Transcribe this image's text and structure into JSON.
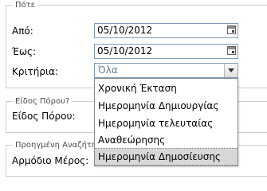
{
  "when_section": {
    "legend": "Πότε",
    "from_label": "Από:",
    "from_value": "05/10/2012",
    "to_label": "Έως:",
    "to_value": "05/10/2012",
    "criteria_label": "Κριτήρια:",
    "criteria_value": "Όλα",
    "criteria_options": [
      "Χρονική Έκταση",
      "Ημερομηνία Δημιουργίας",
      "Ημερομηνία τελευταίας",
      "Αναθεώρησης",
      "Ημερομηνία Δημοσίευσης"
    ],
    "highlighted_option": "Ημερομηνία Δημοσίευσης"
  },
  "resource_section": {
    "legend": "Είδος Πόρου?",
    "type_label": "Είδος Πόρου:"
  },
  "advanced_section": {
    "legend": "Προηγμένη Αναζήτηση",
    "body_label": "Αρμόδιο Μέρος:"
  },
  "icons": {
    "calendar": "calendar-icon",
    "dropdown": "chevron-down-icon"
  },
  "colors": {
    "input_border": "#7f9db9",
    "highlight": "#d7d7d7",
    "placeholder_text": "#6b7e99"
  }
}
